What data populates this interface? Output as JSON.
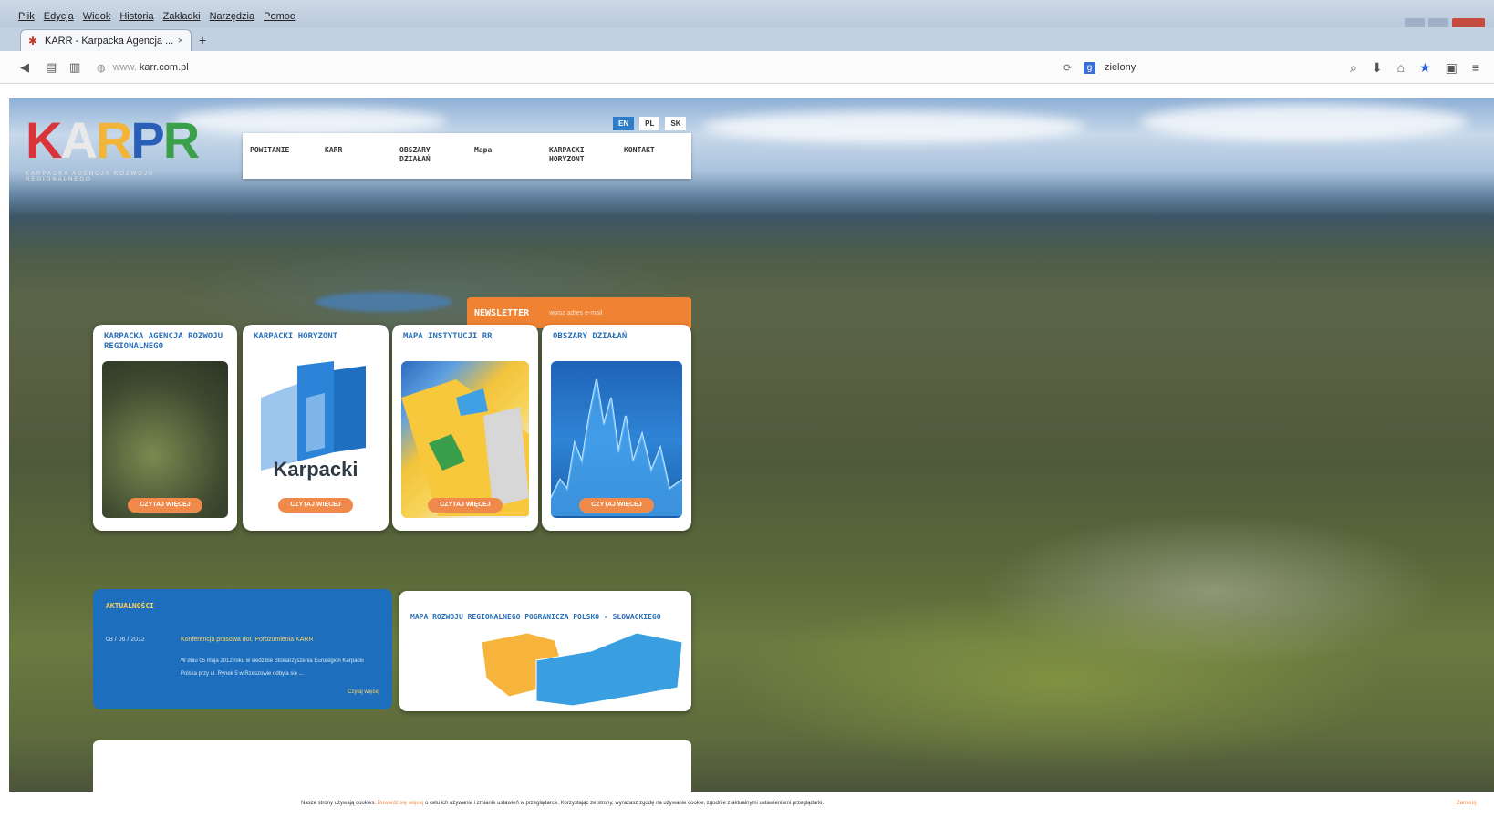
{
  "browser": {
    "menu": [
      "Plik",
      "Edycja",
      "Widok",
      "Historia",
      "Zakładki",
      "Narzędzia",
      "Pomoc"
    ],
    "tab_title": "KARR - Karpacka Agencja ...",
    "url": "karr.com.pl",
    "search_value": "zielony"
  },
  "site": {
    "logo": {
      "letters": [
        "K",
        "A",
        "R",
        "P",
        "R"
      ],
      "subtitle": "KARPACKA AGENCJA ROZWOJU REGIONALNEGO"
    },
    "languages": [
      "EN",
      "PL",
      "SK"
    ],
    "selected_language": "EN",
    "nav": [
      "POWITANIE",
      "KARR",
      "OBSZARY DZIAŁAŃ",
      "Mapa",
      "KARPACKI HORYZONT",
      "KONTAKT"
    ],
    "newsletter": {
      "label": "NEWSLETTER",
      "placeholder": "wpisz adres e-mail"
    },
    "cards": [
      {
        "title": "KARPACKA AGENCJA ROZWOJU REGIONALNEGO",
        "button": "CZYTAJ WIĘCEJ"
      },
      {
        "title": "KARPACKI HORYZONT",
        "button": "CZYTAJ WIĘCEJ",
        "brand": "Karpacki"
      },
      {
        "title": "MAPA INSTYTUCJI RR",
        "button": "CZYTAJ WIĘCEJ"
      },
      {
        "title": "OBSZARY DZIAŁAŃ",
        "button": "CZYTAJ WIĘCEJ"
      }
    ],
    "news": {
      "title": "AKTUALNOŚCI",
      "date": "08 / 06 / 2012",
      "headline": "Konferencja prasowa dot. Porozumienia KARR",
      "body": "W dniu 05 maja 2012 roku w siedzibie Stowarzyszenia Euroregion Karpacki Polska przy ul. Rynek 5 w Rzeszowie odbyła się ...",
      "more": "Czytaj więcej"
    },
    "map": {
      "title": "MAPA ROZWOJU REGIONALNEGO POGRANICZA POLSKO - SŁOWACKIEGO"
    },
    "cookie": {
      "text_before": "Nasze strony używają cookies.",
      "link": "Dowiedz się więcej",
      "text_after": "o celu ich używania i zmianie ustawień w przeglądarce. Korzystając ze strony, wyrażasz zgodę na używanie cookie, zgodnie z aktualnymi ustawieniami przeglądarki.",
      "close": "Zamknij"
    }
  },
  "colors": {
    "accent_orange": "#f08a4b",
    "accent_blue": "#2c71b8",
    "news_blue": "#1d6fbd"
  },
  "icons": [
    "back-icon",
    "home-icon",
    "reload-icon",
    "search-icon",
    "download-icon",
    "bookmark-star-icon",
    "menu-icon"
  ]
}
